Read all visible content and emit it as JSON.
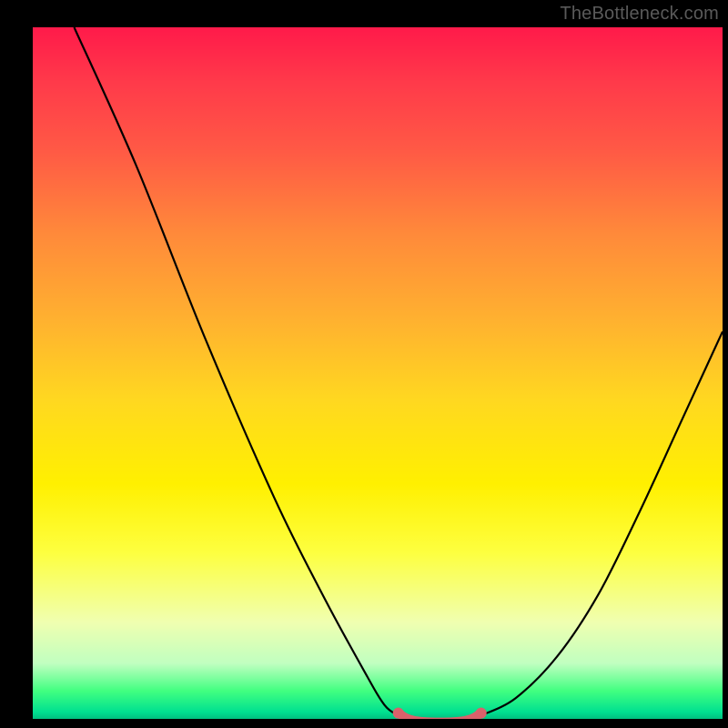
{
  "watermark": "TheBottleneck.com",
  "chart_data": {
    "type": "line",
    "title": "",
    "xlabel": "",
    "ylabel": "",
    "xlim": [
      0,
      100
    ],
    "ylim": [
      0,
      100
    ],
    "curve_left": {
      "description": "descending curve from top-left to valley",
      "x": [
        6,
        15,
        25,
        35,
        42,
        48,
        51,
        53
      ],
      "y": [
        100,
        80,
        55,
        32,
        18,
        7,
        2,
        0.5
      ]
    },
    "curve_right": {
      "description": "ascending curve from valley to right edge",
      "x": [
        65,
        70,
        76,
        82,
        88,
        94,
        100
      ],
      "y": [
        0.5,
        3,
        9,
        18,
        30,
        43,
        56
      ]
    },
    "valley_marker": {
      "description": "highlighted flat valley section (red/coral marker band)",
      "x_start": 53,
      "x_end": 65,
      "y": 0.7,
      "color": "#d9616b"
    },
    "background": {
      "type": "vertical_gradient",
      "stops": [
        {
          "pos": 0,
          "color": "#ff1a4a"
        },
        {
          "pos": 30,
          "color": "#ff8a3a"
        },
        {
          "pos": 60,
          "color": "#fff000"
        },
        {
          "pos": 92,
          "color": "#c0ffc0"
        },
        {
          "pos": 100,
          "color": "#00c080"
        }
      ]
    }
  }
}
